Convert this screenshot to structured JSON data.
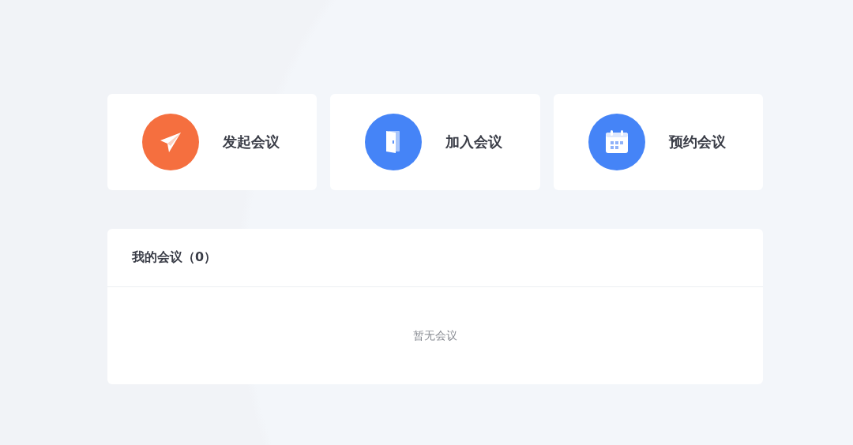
{
  "actions": [
    {
      "kind": "send",
      "label": "发起会议",
      "color": "#f56f3f"
    },
    {
      "kind": "door",
      "label": "加入会议",
      "color": "#4584f7"
    },
    {
      "kind": "calendar",
      "label": "预约会议",
      "color": "#4584f7"
    }
  ],
  "meetings_panel": {
    "title": "我的会议（0）",
    "empty_text": "暂无会议"
  }
}
